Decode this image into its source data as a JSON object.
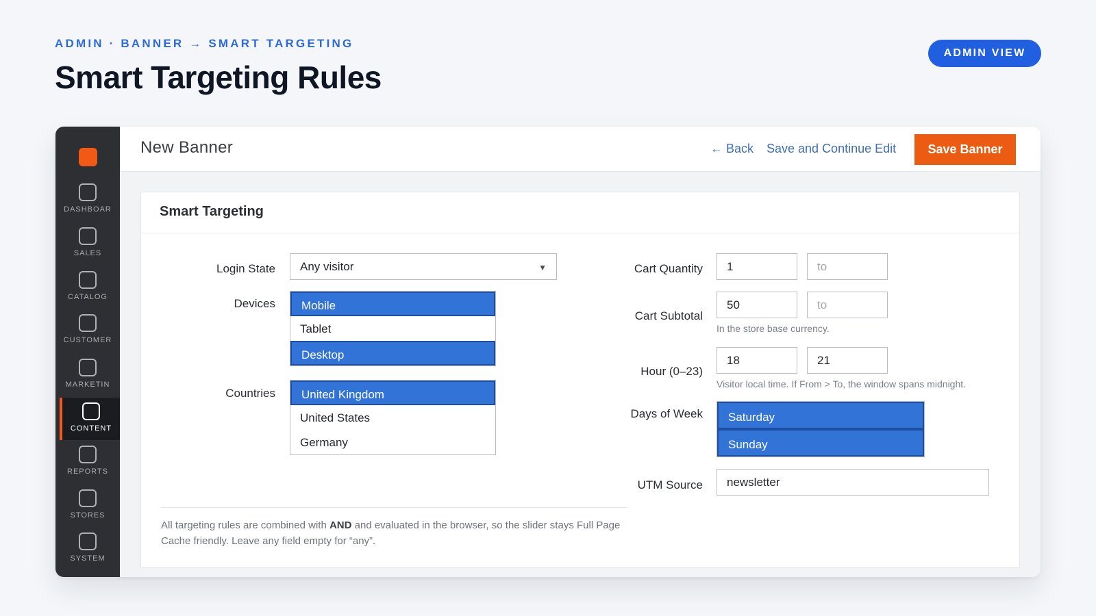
{
  "header": {
    "breadcrumb": "ADMIN · BANNER → SMART TARGETING",
    "title": "Smart Targeting Rules",
    "badge": "ADMIN VIEW"
  },
  "colors": {
    "accent": "#eb5c12",
    "badge": "#1f5fe0",
    "selected": "#3273d8",
    "sidebar": "#2d2f33"
  },
  "sidebar": {
    "logo_icon": "logo-square-icon",
    "items": [
      {
        "label": "DASHBOAR",
        "icon": "dashboard-icon"
      },
      {
        "label": "SALES",
        "icon": "sales-icon"
      },
      {
        "label": "CATALOG",
        "icon": "catalog-icon"
      },
      {
        "label": "CUSTOMER",
        "icon": "customer-icon"
      },
      {
        "label": "MARKETIN",
        "icon": "marketing-icon"
      },
      {
        "label": "CONTENT",
        "icon": "content-icon",
        "active": true
      },
      {
        "label": "REPORTS",
        "icon": "reports-icon"
      },
      {
        "label": "STORES",
        "icon": "stores-icon"
      },
      {
        "label": "SYSTEM",
        "icon": "system-icon"
      }
    ]
  },
  "topbar": {
    "title": "New Banner",
    "back_label": "← Back",
    "continue_label": "Save and Continue Edit",
    "save_label": "Save Banner"
  },
  "panel": {
    "title": "Smart Targeting",
    "login_state": {
      "label": "Login State",
      "value": "Any visitor"
    },
    "devices": {
      "label": "Devices",
      "options": [
        {
          "label": "Mobile",
          "selected": true
        },
        {
          "label": "Tablet",
          "selected": false
        },
        {
          "label": "Desktop",
          "selected": true
        }
      ]
    },
    "countries": {
      "label": "Countries",
      "options": [
        {
          "label": "United Kingdom",
          "selected": true
        },
        {
          "label": "United States",
          "selected": false
        },
        {
          "label": "Germany",
          "selected": false
        }
      ]
    },
    "cart_quantity": {
      "label": "Cart Quantity",
      "from": "1",
      "to_placeholder": "to"
    },
    "cart_subtotal": {
      "label": "Cart Subtotal",
      "from": "50",
      "to_placeholder": "to",
      "hint": "In the store base currency."
    },
    "hour": {
      "label": "Hour (0–23)",
      "from": "18",
      "to": "21",
      "hint": "Visitor local time. If From > To, the window spans midnight."
    },
    "days_of_week": {
      "label": "Days of Week",
      "options": [
        {
          "label": "Saturday",
          "selected": true
        },
        {
          "label": "Sunday",
          "selected": true
        }
      ]
    },
    "utm_source": {
      "label": "UTM Source",
      "value": "newsletter"
    },
    "footnote": {
      "prefix": "All targeting rules are combined with ",
      "bold": "AND",
      "suffix": " and evaluated in the browser, so the slider stays Full Page Cache friendly. Leave any field empty for “any”."
    }
  }
}
